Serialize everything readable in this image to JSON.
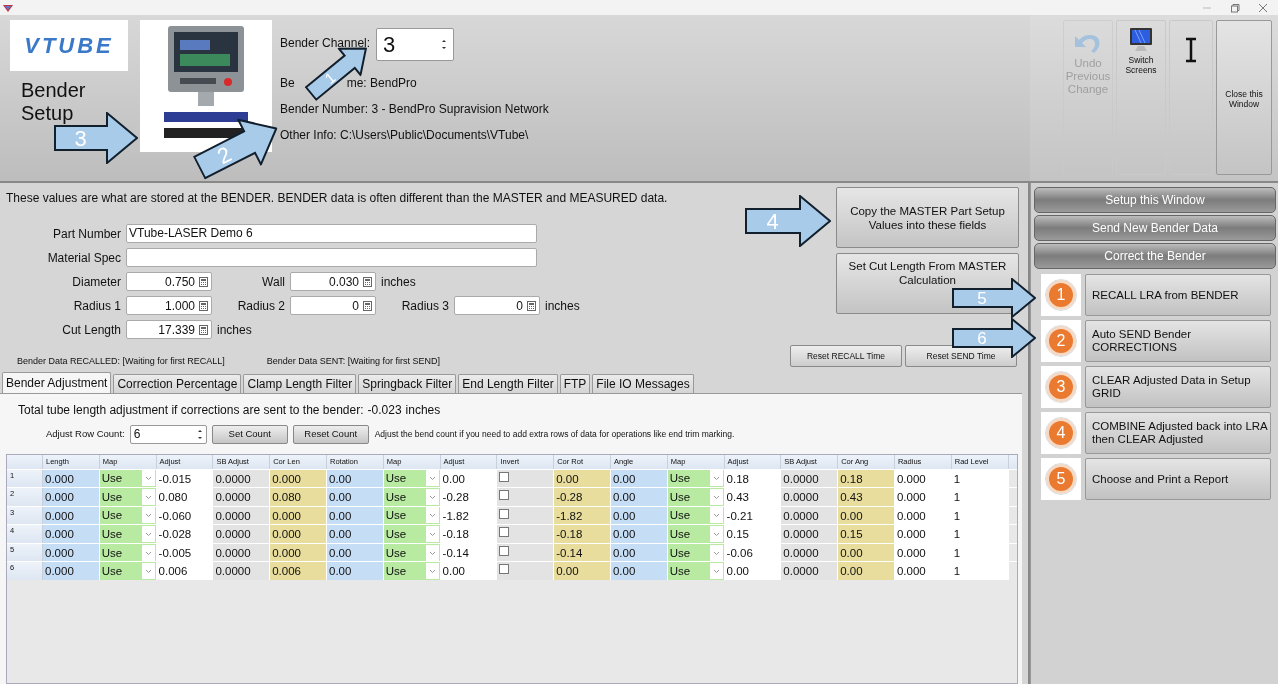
{
  "header": {
    "logo_text": "VTUBE",
    "title": "Bender Setup",
    "channel_label": "Bender Channel:",
    "channel_value": "3",
    "name_parts": [
      "Be",
      "me: BendPro"
    ],
    "bender_number": "Bender Number: 3 - BendPro Supravision Network",
    "other_info": "Other Info: C:\\Users\\Public\\Documents\\VTube\\"
  },
  "toolbar": [
    {
      "kind": "undo",
      "label": "Undo Previous Change",
      "disabled": true
    },
    {
      "kind": "screen",
      "label": "Switch Screens",
      "disabled": false
    },
    {
      "kind": "cursor",
      "disabled": false
    },
    {
      "kind": "close",
      "label": "Close this Window",
      "disabled": false
    }
  ],
  "notice": "These values are what are stored at the BENDER.  BENDER data is often different than the MASTER and MEASURED data.",
  "text_fields": [
    {
      "label": "Part Number",
      "value": "VTube-LASER Demo 6"
    },
    {
      "label": "Material Spec"
    }
  ],
  "numeric_rows": [
    {
      "fields": [
        {
          "label": "Diameter",
          "value": "0.750"
        },
        {
          "label": "Wall",
          "value": "0.030"
        }
      ],
      "unit": "inches"
    },
    {
      "fields": [
        {
          "label": "Radius 1",
          "value": "1.000"
        },
        {
          "label": "Radius 2",
          "value": "0"
        },
        {
          "label": "Radius 3",
          "value": "0"
        }
      ],
      "unit": "inches"
    },
    {
      "fields": [
        {
          "label": "Cut Length",
          "value": "17.339"
        }
      ],
      "unit": "inches"
    }
  ],
  "status": [
    "Bender Data RECALLED: [Waiting for first RECALL]",
    "Bender Data SENT: [Waiting for first SEND]"
  ],
  "action_buttons": [
    "Copy the MASTER Part Setup Values into these fields",
    "Set Cut Length From MASTER Calculation"
  ],
  "reset_buttons": [
    "Reset RECALL Time",
    "Reset SEND Time"
  ],
  "tabs": [
    {
      "label": "Bender Adjustment",
      "selected": true
    },
    {
      "label": "Correction Percentage",
      "selected": false
    },
    {
      "label": "Clamp Length Filter",
      "selected": false
    },
    {
      "label": "Springback Filter",
      "selected": false
    },
    {
      "label": "End Length Filter",
      "selected": false
    },
    {
      "label": "FTP",
      "selected": false
    },
    {
      "label": "File IO Messages",
      "selected": false
    }
  ],
  "adjustment": {
    "total_label": "Total tube length adjustment if corrections are sent to the bender:",
    "total_value": "-0.023",
    "total_unit": "inches",
    "row_count_label": "Adjust Row Count:",
    "row_count": "6",
    "buttons": [
      "Set Count",
      "Reset Count"
    ],
    "hint": "Adjust the bend count if you need to add extra rows of data for operations like end trim marking."
  },
  "table": {
    "columns": [
      {
        "label": "Length",
        "kind": "measured"
      },
      {
        "label": "Map",
        "kind": "map"
      },
      {
        "label": "Adjust",
        "kind": "adjust"
      },
      {
        "label": "SB Adjust",
        "kind": "computed"
      },
      {
        "label": "Cor Len",
        "kind": "correction"
      },
      {
        "label": "Rotation",
        "kind": "measured"
      },
      {
        "label": "Map",
        "kind": "map"
      },
      {
        "label": "Adjust",
        "kind": "adjust"
      },
      {
        "label": "Invert",
        "kind": "check"
      },
      {
        "label": "Cor Rot",
        "kind": "correction"
      },
      {
        "label": "Angle",
        "kind": "measured"
      },
      {
        "label": "Map",
        "kind": "map"
      },
      {
        "label": "Adjust",
        "kind": "adjust"
      },
      {
        "label": "SB Adjust",
        "kind": "computed"
      },
      {
        "label": "Cor Ang",
        "kind": "correction"
      },
      {
        "label": "Radius",
        "kind": "plain"
      },
      {
        "label": "Rad Level",
        "kind": "plain"
      }
    ],
    "rows": [
      {
        "header": "1",
        "cells": [
          "0.000",
          "Use",
          "-0.015",
          "0.0000",
          "0.000",
          "0.00",
          "Use",
          "0.00",
          false,
          "0.00",
          "0.00",
          "Use",
          "0.18",
          "0.0000",
          "0.18",
          "0.000",
          "1"
        ]
      },
      {
        "header": "2",
        "cells": [
          "0.000",
          "Use",
          "0.080",
          "0.0000",
          "0.080",
          "0.00",
          "Use",
          "-0.28",
          false,
          "-0.28",
          "0.00",
          "Use",
          "0.43",
          "0.0000",
          "0.43",
          "0.000",
          "1"
        ]
      },
      {
        "header": "3",
        "cells": [
          "0.000",
          "Use",
          "-0.060",
          "0.0000",
          "0.000",
          "0.00",
          "Use",
          "-1.82",
          false,
          "-1.82",
          "0.00",
          "Use",
          "-0.21",
          "0.0000",
          "0.00",
          "0.000",
          "1"
        ]
      },
      {
        "header": "4",
        "cells": [
          "0.000",
          "Use",
          "-0.028",
          "0.0000",
          "0.000",
          "0.00",
          "Use",
          "-0.18",
          false,
          "-0.18",
          "0.00",
          "Use",
          "0.15",
          "0.0000",
          "0.15",
          "0.000",
          "1"
        ]
      },
      {
        "header": "5",
        "cells": [
          "0.000",
          "Use",
          "-0.005",
          "0.0000",
          "0.000",
          "0.00",
          "Use",
          "-0.14",
          false,
          "-0.14",
          "0.00",
          "Use",
          "-0.06",
          "0.0000",
          "0.00",
          "0.000",
          "1"
        ]
      },
      {
        "header": "6",
        "cells": [
          "0.000",
          "Use",
          "0.006",
          "0.0000",
          "0.006",
          "0.00",
          "Use",
          "0.00",
          false,
          "0.00",
          "0.00",
          "Use",
          "0.00",
          "0.0000",
          "0.00",
          "0.000",
          "1"
        ]
      }
    ]
  },
  "panel": {
    "sections": [
      "Setup this Window",
      "Send New Bender Data",
      "Correct the Bender"
    ],
    "steps": [
      {
        "number": "1",
        "label": "RECALL LRA from BENDER"
      },
      {
        "number": "2",
        "label": "Auto SEND Bender CORRECTIONS"
      },
      {
        "number": "3",
        "label": "CLEAR Adjusted Data in Setup GRID"
      },
      {
        "number": "4",
        "label": "COMBINE Adjusted back into LRA\nthen CLEAR Adjusted"
      },
      {
        "number": "5",
        "label": "Choose and Print a Report"
      }
    ]
  },
  "callouts": [
    {
      "number": "1"
    },
    {
      "number": "2"
    },
    {
      "number": "3"
    },
    {
      "number": "4"
    },
    {
      "number": "5"
    },
    {
      "number": "6"
    }
  ]
}
